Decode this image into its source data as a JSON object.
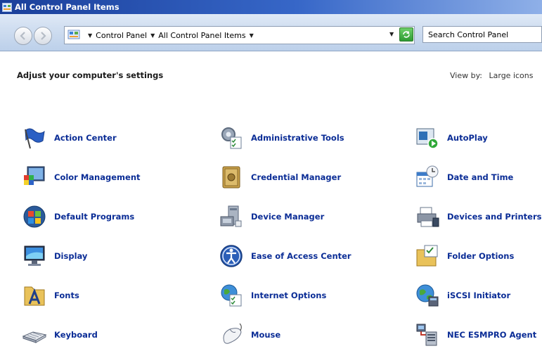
{
  "window": {
    "title": "All Control Panel Items"
  },
  "address": {
    "crumbs": [
      "Control Panel",
      "All Control Panel Items"
    ]
  },
  "search": {
    "placeholder": "Search Control Panel"
  },
  "main": {
    "heading": "Adjust your computer's settings",
    "view_by_label": "View by:",
    "view_by_value": "Large icons"
  },
  "items": [
    {
      "label": "Action Center",
      "icon": "flag-icon"
    },
    {
      "label": "Administrative Tools",
      "icon": "admin-tools-icon"
    },
    {
      "label": "AutoPlay",
      "icon": "autoplay-icon"
    },
    {
      "label": "Color Management",
      "icon": "color-management-icon"
    },
    {
      "label": "Credential Manager",
      "icon": "vault-icon"
    },
    {
      "label": "Date and Time",
      "icon": "calendar-clock-icon"
    },
    {
      "label": "Default Programs",
      "icon": "windows-orb-icon"
    },
    {
      "label": "Device Manager",
      "icon": "device-manager-icon"
    },
    {
      "label": "Devices and Printers",
      "icon": "printer-icon"
    },
    {
      "label": "Display",
      "icon": "monitor-icon"
    },
    {
      "label": "Ease of Access Center",
      "icon": "accessibility-icon"
    },
    {
      "label": "Folder Options",
      "icon": "folder-options-icon"
    },
    {
      "label": "Fonts",
      "icon": "fonts-icon"
    },
    {
      "label": "Internet Options",
      "icon": "globe-checklist-icon"
    },
    {
      "label": "iSCSI Initiator",
      "icon": "globe-network-icon"
    },
    {
      "label": "Keyboard",
      "icon": "keyboard-icon"
    },
    {
      "label": "Mouse",
      "icon": "mouse-icon"
    },
    {
      "label": "NEC ESMPRO Agent",
      "icon": "server-agent-icon"
    }
  ]
}
